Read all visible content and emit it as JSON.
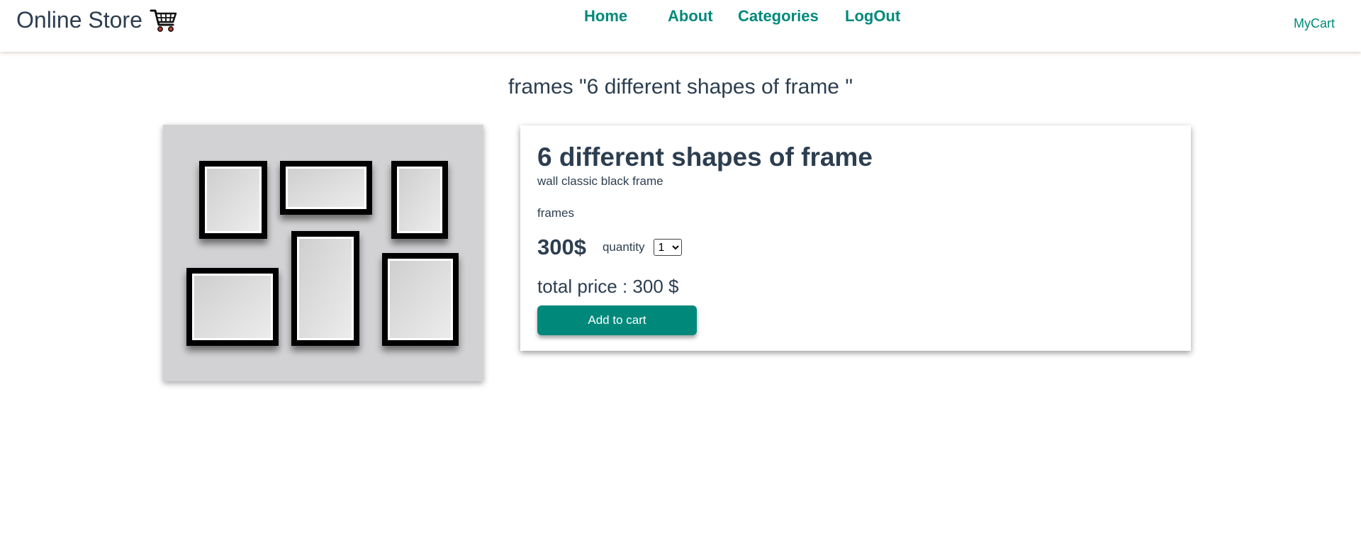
{
  "brand": {
    "name": "Online Store",
    "icon": "shopping-cart-icon"
  },
  "nav": {
    "home": "Home",
    "about": "About",
    "categories": "Categories",
    "logout": "LogOut",
    "mycart": "MyCart"
  },
  "page": {
    "title": "frames \"6 different shapes of frame \""
  },
  "product": {
    "name": "6 different shapes of frame",
    "description": "wall classic black frame",
    "category": "frames",
    "price": "300$",
    "quantity_label": "quantity",
    "quantity_selected": "1",
    "total_price": "total price : 300 $",
    "add_button": "Add to cart"
  },
  "colors": {
    "accent": "#00897b",
    "text": "#2c3e50",
    "image_bg": "#d2d2d4"
  }
}
